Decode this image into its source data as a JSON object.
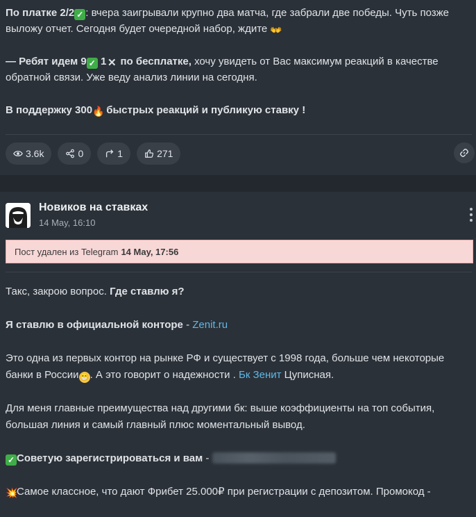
{
  "post1": {
    "line1_bold": "По платке 2/2",
    "line1_rest": ": вчера заигрывали крупно два матча, где забрали две победы. Чуть позже выложу отчет. Сегодня будет очередной набор, ждите",
    "line2_bold_a": "— Ребят идем 9",
    "line2_bold_b": "1",
    "line2_bold_c": "по бесплатке,",
    "line2_rest": " хочу увидеть от Вас максимум реакций в качестве обратной связи. Уже веду анализ линии на сегодня.",
    "line3_bold_a": "В поддержку 300",
    "line3_bold_b": " быстрых реакций и публикую ставку !",
    "stats": {
      "views": "3.6k",
      "shares": "0",
      "forwards": "1",
      "likes": "271"
    }
  },
  "post2": {
    "channel_name": "Новиков на ставках",
    "date": "14 May, 16:10",
    "deleted_text": "Пост удален из Telegram",
    "deleted_date": "14 May, 17:56",
    "para1_plain": "Такс, закрою вопрос. ",
    "para1_bold": "Где ставлю я?",
    "para2_bold": "Я ставлю в официальной конторе",
    "para2_dash": " - ",
    "para2_link": "Zenit.ru",
    "para3_a": "Это одна из первых контор на рынке РФ и существует с 1998 года, больше чем некоторые банки в России",
    "para3_b": ". А это говорит о надежности . ",
    "para3_link": "Бк Зенит",
    "para3_c": " Цуписная.",
    "para4": "Для меня главные преимущества над другими бк: выше коэффициенты на топ события, большая линия и самый главный плюс моментальный вывод.",
    "para5_bold": "Советую зарегистрироваться и вам",
    "para5_dash": " - ",
    "para6": "Самое классное, что дают Фрибет 25.000₽ при регистрации с депозитом. Промокод -"
  },
  "icons": {
    "check": "✓",
    "cross": "✕",
    "fire": "🔥",
    "hand": "👐",
    "grin": "😁",
    "boom": "💥"
  }
}
